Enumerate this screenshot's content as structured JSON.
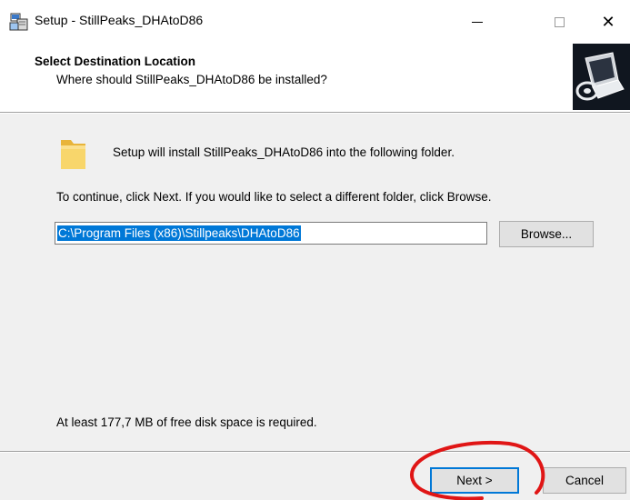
{
  "window": {
    "title": "Setup - StillPeaks_DHAtoD86",
    "controls": {
      "minimize_icon": "minimize-icon",
      "maximize_icon": "maximize-icon",
      "close_glyph": "✕"
    }
  },
  "header": {
    "title": "Select Destination Location",
    "subtitle": "Where should StillPeaks_DHAtoD86 be installed?"
  },
  "body": {
    "intro": "Setup will install StillPeaks_DHAtoD86 into the following folder.",
    "instructions": "To continue, click Next. If you would like to select a different folder, click Browse.",
    "path_value": "C:\\Program Files (x86)\\Stillpeaks\\DHAtoD86",
    "browse_label": "Browse...",
    "disk_space": "At least 177,7 MB of free disk space is required."
  },
  "footer": {
    "next_label": "Next >",
    "cancel_label": "Cancel"
  },
  "colors": {
    "selection": "#0078d7",
    "annotation": "#e01515",
    "folder": "#f5c842"
  }
}
